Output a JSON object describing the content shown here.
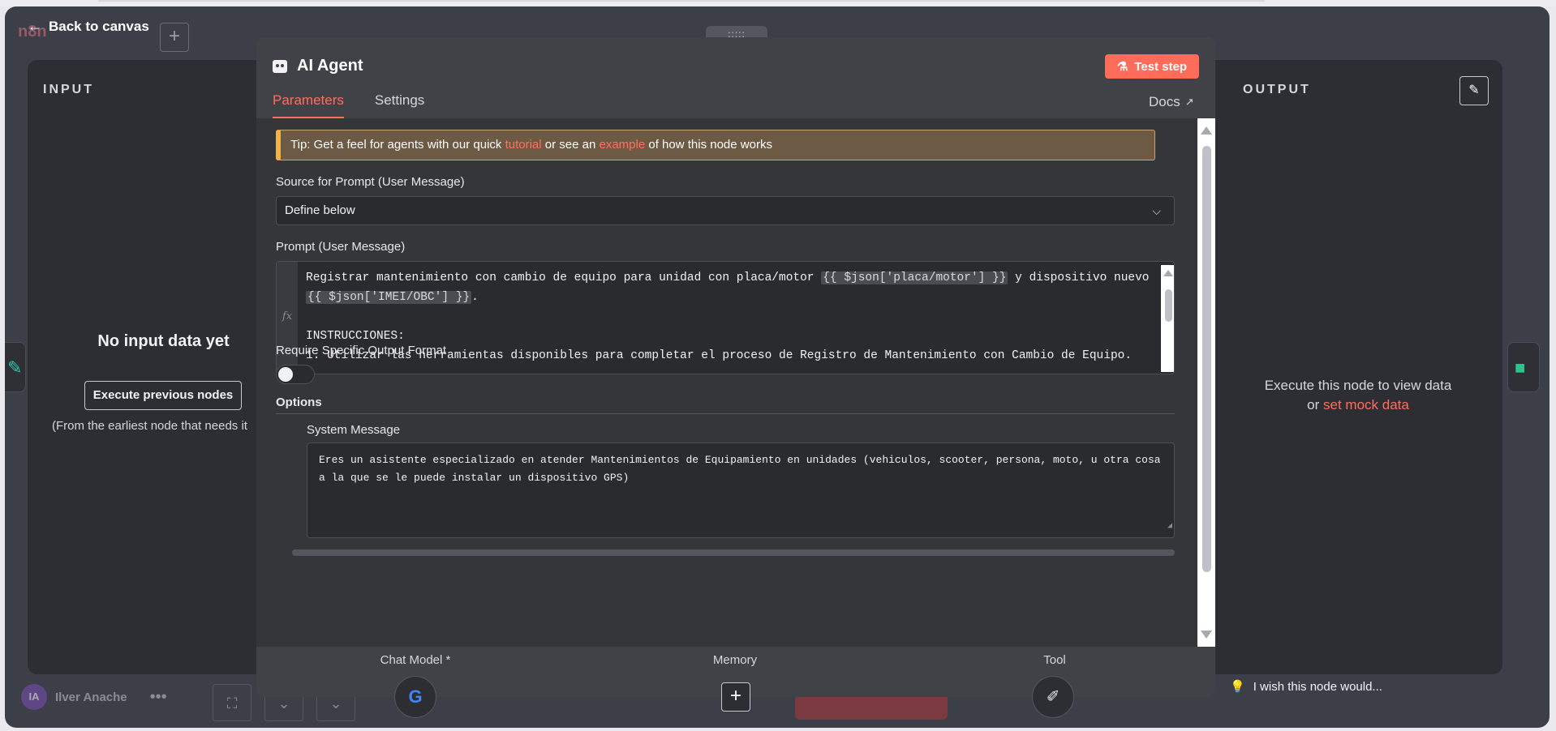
{
  "canvas": {
    "brand": "n8n",
    "add_label": "+",
    "user_initials": "IA",
    "user_name": "Ilver Anache",
    "more_label": "•••"
  },
  "back_to_canvas": "Back to canvas",
  "input_panel": {
    "title": "INPUT",
    "empty_title": "No input data yet",
    "execute_button": "Execute previous nodes",
    "note": "(From the earliest node that needs it"
  },
  "output_panel": {
    "title": "OUTPUT",
    "message_line1": "Execute this node to view data",
    "message_or": "or",
    "mock_link": "set mock data",
    "wish": "I wish this node would..."
  },
  "modal": {
    "drag_handle": ":::::",
    "title": "AI Agent",
    "test_step": "Test step",
    "tabs": [
      {
        "label": "Parameters",
        "active": true
      },
      {
        "label": "Settings",
        "active": false
      }
    ],
    "docs": "Docs",
    "tip": {
      "prefix": "Tip: Get a feel for agents with our quick",
      "link1": "tutorial",
      "middle": "or see an",
      "link2": "example",
      "suffix": "of how this node works"
    },
    "source_label": "Source for Prompt (User Message)",
    "source_value": "Define below",
    "prompt_label": "Prompt (User Message)",
    "prompt": {
      "line1_a": "Registrar mantenimiento con cambio de equipo para unidad con placa/motor",
      "expr1": "{{ $json['placa/motor'] }}",
      "line1_b": "y dispositivo nuevo",
      "expr2": "{{ $json['IMEI/OBC'] }}",
      "line2_b": ".",
      "line4": "INSTRUCCIONES:",
      "line5": "1. Utilizar las herramientas disponibles para completar el proceso de Registro de Mantenimiento con Cambio de Equipo."
    },
    "fx_label": "fx",
    "require_format_label": "Require Specific Output Format",
    "require_format_enabled": false,
    "options_label": "Options",
    "system_message_label": "System Message",
    "system_message": "Eres un asistente especializado en atender Mantenimientos de Equipamiento en unidades (vehiculos, scooter, persona, moto, u otra cosa a la que se le puede instalar un dispositivo GPS)",
    "connectors": {
      "chat_model": "Chat Model *",
      "memory": "Memory",
      "tool": "Tool"
    }
  },
  "colors": {
    "accent": "#ff6d5a",
    "panel_bg": "#2d2e33",
    "modal_bg": "#414247",
    "tip_border": "#f2b24a"
  }
}
